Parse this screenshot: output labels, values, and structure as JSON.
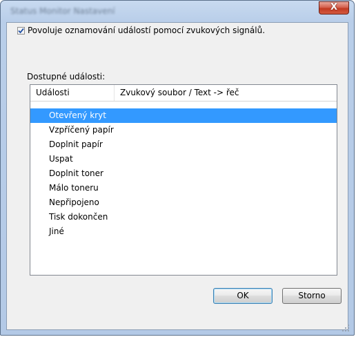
{
  "window": {
    "title": "Status Monitor Nastavení",
    "close_label": "X"
  },
  "notify_checkbox": {
    "checked": true,
    "label": "Povoluje oznamování událostí pomocí zvukových signálů."
  },
  "events": {
    "group_label": "Dostupné události:",
    "columns": [
      "Události",
      "Zvukový soubor / Text -> řeč"
    ],
    "items": [
      "Otevřený kryt",
      "Vzpříčený papír",
      "Doplnit papír",
      "Uspat",
      "Doplnit toner",
      "Málo toneru",
      "Nepřipojeno",
      "Tisk dokončen",
      "Jiné"
    ],
    "selected_index": 0
  },
  "buttons": {
    "ok": "OK",
    "cancel": "Storno"
  },
  "colors": {
    "selection": "#3399ff",
    "close_button": "#c23a22"
  }
}
